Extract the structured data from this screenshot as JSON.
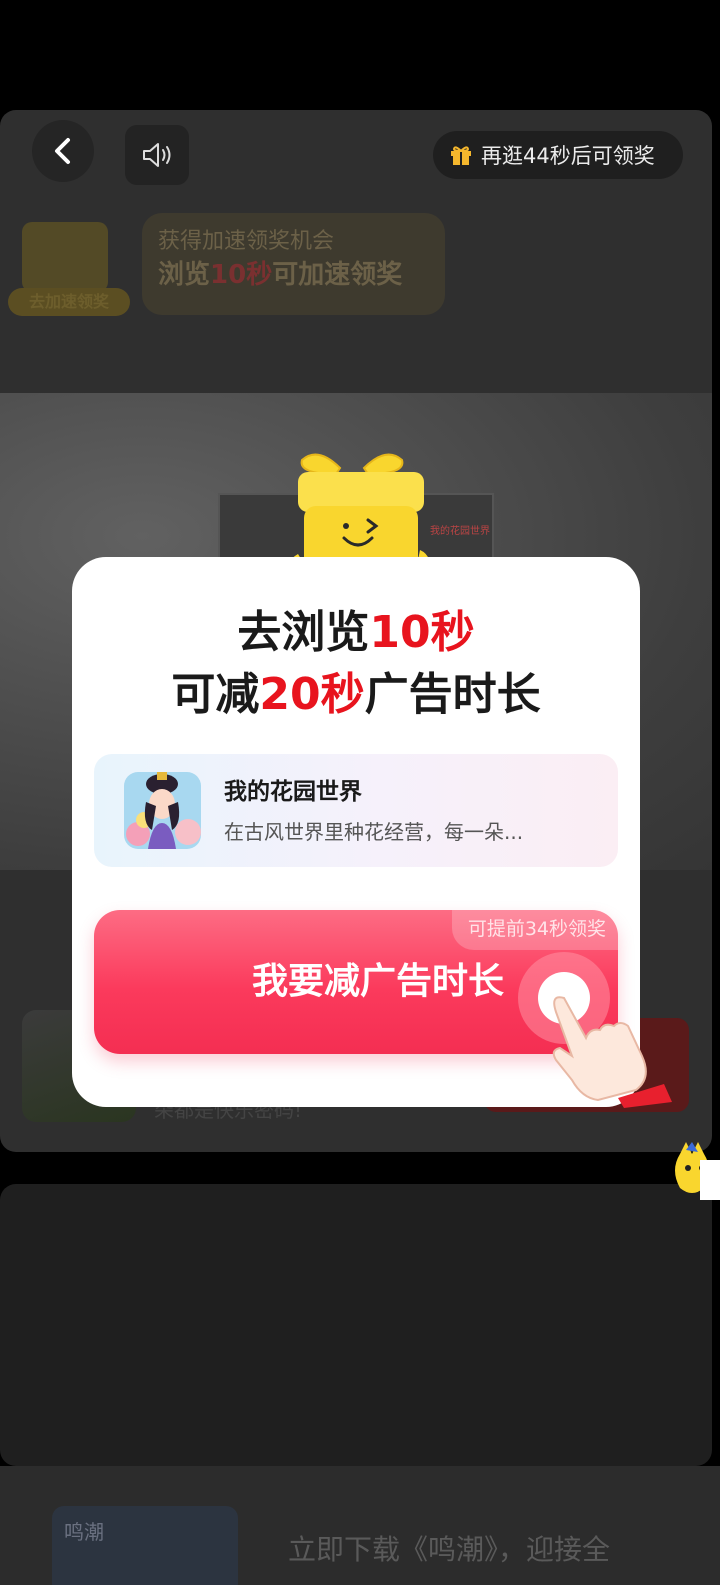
{
  "header": {
    "back_icon": "chevron-left-icon",
    "sound_icon": "speaker-icon",
    "reward_timer": {
      "icon": "gift-icon",
      "text": "再逛44秒后可领奖"
    }
  },
  "background": {
    "speed_tip": {
      "line1": "获得加速领奖机会",
      "line2_prefix": "浏览",
      "line2_highlight": "10秒",
      "line2_suffix": "可加速领奖"
    },
    "gift_badge_label": "去加速领奖",
    "hero_caption": "我的花园世界",
    "game_text": "朵都是快乐密码!",
    "bottom": {
      "thumb_text": "鸣潮",
      "download_text": "立即下载《鸣潮》，迎接全"
    }
  },
  "modal": {
    "title_line1": {
      "prefix": "去浏览",
      "highlight": "10秒"
    },
    "title_line2": {
      "prefix": "可减",
      "highlight": "20秒",
      "suffix": "广告时长"
    },
    "app": {
      "name": "我的花园世界",
      "description": "在古风世界里种花经营，每一朵..."
    },
    "cta": {
      "label": "我要减广告时长",
      "tag": "可提前34秒领奖"
    }
  },
  "colors": {
    "accent_red": "#e8141e",
    "cta_pink": "#fb3a5c",
    "gift_yellow": "#f9d62e"
  }
}
